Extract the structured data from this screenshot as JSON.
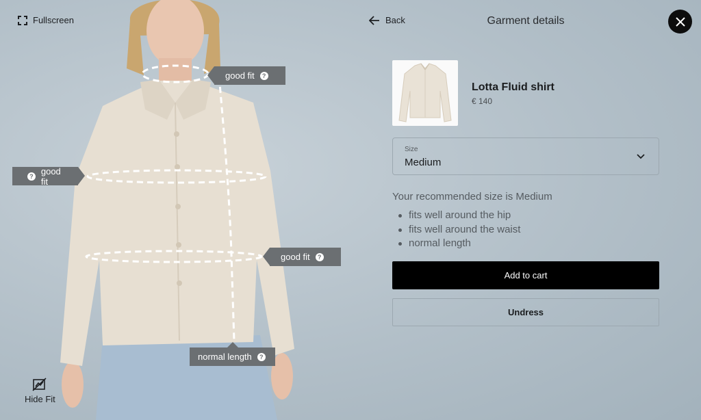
{
  "left": {
    "fullscreen_label": "Fullscreen",
    "hide_fit_label": "Hide Fit",
    "fit_tags": [
      "good fit",
      "good fit",
      "good fit",
      "normal length"
    ]
  },
  "header": {
    "back_label": "Back",
    "title": "Garment details"
  },
  "product": {
    "name": "Lotta Fluid shirt",
    "price": "€ 140"
  },
  "size_select": {
    "label": "Size",
    "value": "Medium"
  },
  "recommendation": {
    "text": "Your recommended size is Medium",
    "reasons": [
      "fits well around the hip",
      "fits well around the waist",
      "normal length"
    ]
  },
  "actions": {
    "add_to_cart": "Add to cart",
    "undress": "Undress"
  },
  "colors": {
    "accent": "#000000",
    "tag_bg": "#6b6f72",
    "shirt": "#e7dfd2"
  }
}
